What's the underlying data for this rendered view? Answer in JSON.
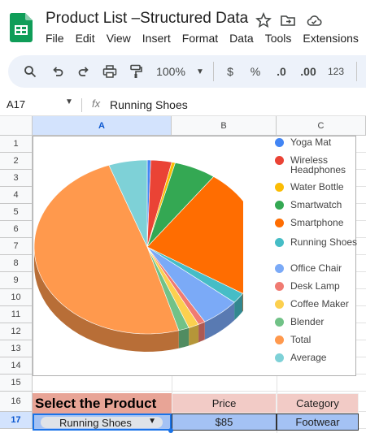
{
  "header": {
    "title": "Product List –Structured Data",
    "menus": [
      "File",
      "Edit",
      "View",
      "Insert",
      "Format",
      "Data",
      "Tools",
      "Extensions"
    ]
  },
  "toolbar": {
    "zoom": "100%",
    "currency": "$",
    "percent": "%",
    "dec_less": ".0",
    "dec_more": ".00",
    "number_format": "123"
  },
  "formula_bar": {
    "cell_ref": "A17",
    "fx": "fx",
    "value": "Running Shoes"
  },
  "columns": [
    "A",
    "B",
    "C"
  ],
  "rows": [
    "1",
    "2",
    "3",
    "4",
    "5",
    "6",
    "7",
    "8",
    "9",
    "10",
    "11",
    "12",
    "13",
    "14",
    "15",
    "16",
    "17"
  ],
  "chart_data": {
    "type": "pie",
    "legend_position": "right",
    "series": [
      {
        "name": "Yoga Mat",
        "value": 0.5,
        "color": "#4285f4"
      },
      {
        "name": "Wireless Headphones",
        "value": 3,
        "color": "#ea4335"
      },
      {
        "name": "Water Bottle",
        "value": 0.5,
        "color": "#fbbc04"
      },
      {
        "name": "Smartwatch",
        "value": 6,
        "color": "#34a853"
      },
      {
        "name": "Smartphone",
        "value": 24,
        "color": "#ff6d01"
      },
      {
        "name": "Running Shoes",
        "value": 2,
        "color": "#46bdc6"
      },
      {
        "name": "Office Chair",
        "value": 5.5,
        "color": "#7baaf7"
      },
      {
        "name": "Desk Lamp",
        "value": 1,
        "color": "#f07b72"
      },
      {
        "name": "Coffee Maker",
        "value": 1.5,
        "color": "#fcd04f"
      },
      {
        "name": "Blender",
        "value": 1.5,
        "color": "#71c287"
      },
      {
        "name": "Total",
        "value": 49,
        "color": "#ff994d"
      },
      {
        "name": "Average",
        "value": 5.5,
        "color": "#7ed1d7"
      }
    ]
  },
  "cells": {
    "a16": "Select the Product",
    "b16": "Price",
    "c16": "Category",
    "a17": "Running Shoes",
    "b17": "$85",
    "c17": "Footwear"
  }
}
